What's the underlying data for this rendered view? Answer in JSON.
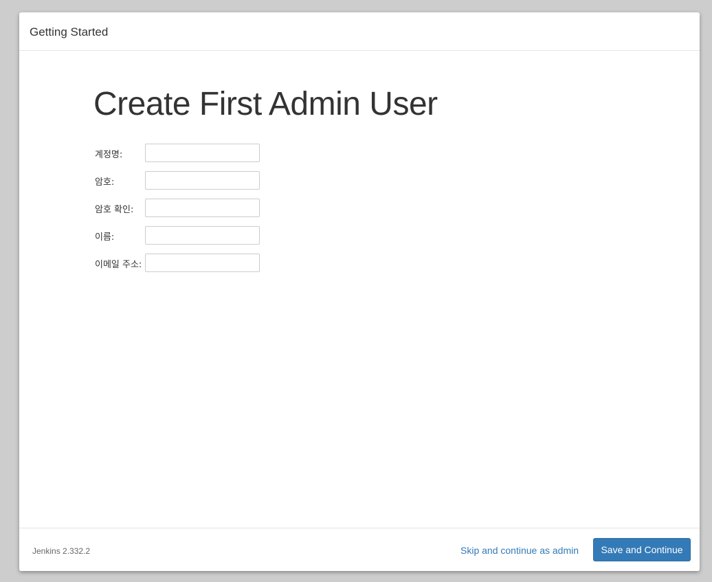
{
  "dialog": {
    "title": "Getting Started"
  },
  "form": {
    "heading": "Create First Admin User",
    "fields": [
      {
        "label": "계정명:",
        "value": ""
      },
      {
        "label": "암호:",
        "value": ""
      },
      {
        "label": "암호 확인:",
        "value": ""
      },
      {
        "label": "이름:",
        "value": ""
      },
      {
        "label": "이메일 주소:",
        "value": ""
      }
    ]
  },
  "footer": {
    "version": "Jenkins 2.332.2",
    "skip_label": "Skip and continue as admin",
    "save_label": "Save and Continue"
  },
  "colors": {
    "primary_button": "#337ab7",
    "link": "#337ab7",
    "backdrop": "#cdcdcd"
  }
}
